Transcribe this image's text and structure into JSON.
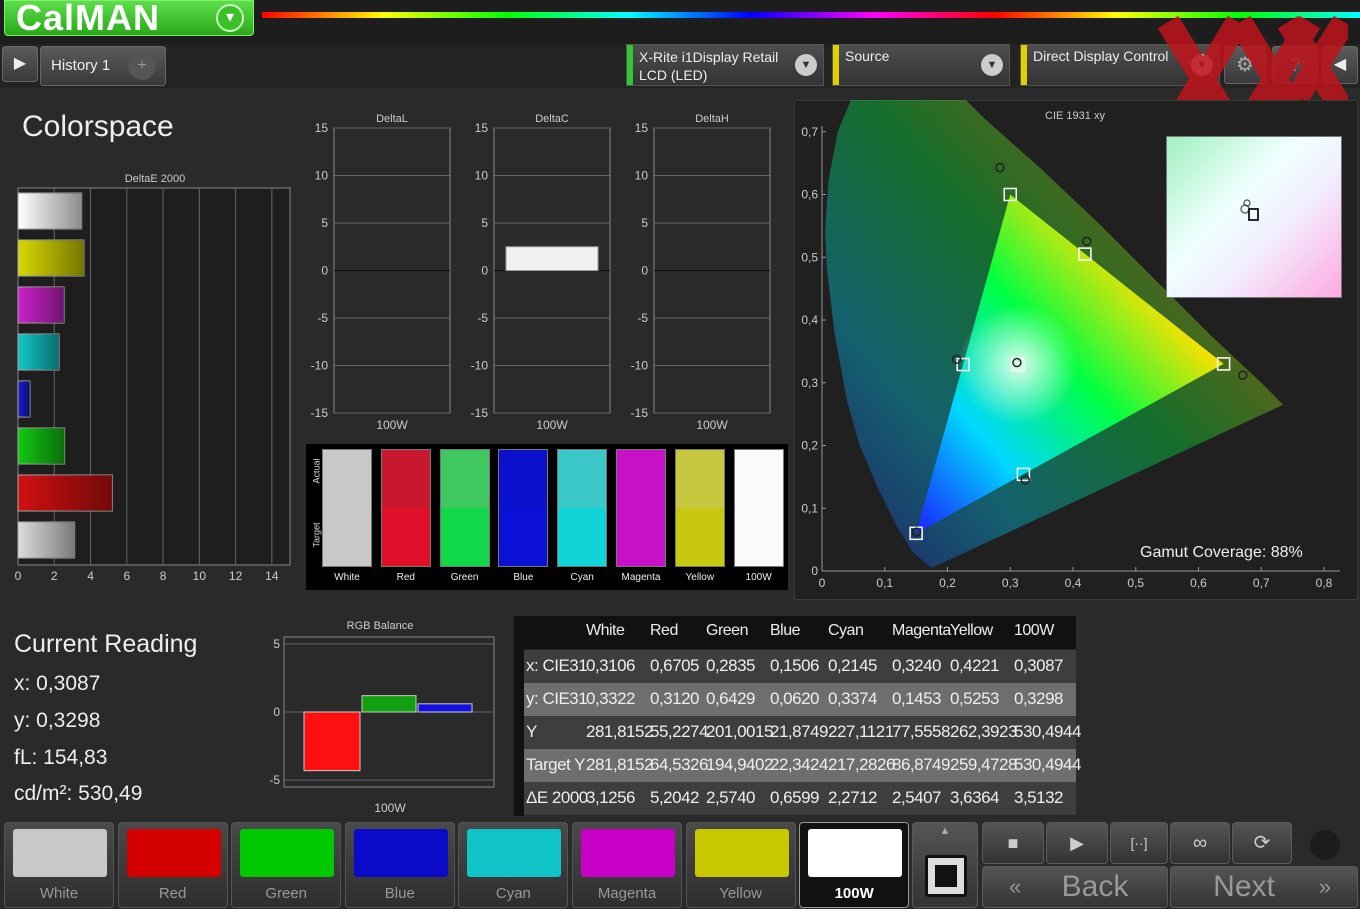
{
  "app": {
    "title": "CalMAN"
  },
  "tabs": {
    "history": "History 1"
  },
  "devices": {
    "meter": "X-Rite i1Display Retail LCD (LED)",
    "source": "Source",
    "display": "Direct Display Control"
  },
  "colorspace": {
    "title": "Colorspace"
  },
  "deltae_chart": {
    "title": "DeltaE 2000",
    "ticks": [
      "0",
      "2",
      "4",
      "6",
      "8",
      "10",
      "12",
      "14"
    ],
    "bars": [
      {
        "value": 3.5126,
        "color": "#ffffff"
      },
      {
        "value": 3.6364,
        "color": "#d8d800"
      },
      {
        "value": 2.5407,
        "color": "#cc22cc"
      },
      {
        "value": 2.2712,
        "color": "#12c8c8"
      },
      {
        "value": 0.6599,
        "color": "#1a1acc"
      },
      {
        "value": 2.574,
        "color": "#12c812"
      },
      {
        "value": 5.2042,
        "color": "#d01010"
      },
      {
        "value": 3.1256,
        "color": "#dddddd"
      }
    ]
  },
  "delta_charts": [
    {
      "title": "DeltaL",
      "label": "100W"
    },
    {
      "title": "DeltaC",
      "label": "100W"
    },
    {
      "title": "DeltaH",
      "label": "100W"
    }
  ],
  "delta_ticks": [
    "15",
    "10",
    "5",
    "0",
    "-5",
    "-10",
    "-15"
  ],
  "swatch_panel": {
    "actual_label": "Actual",
    "target_label": "Target",
    "items": [
      {
        "name": "White",
        "actual": "#c8c8c8",
        "target": "#c8c8c8"
      },
      {
        "name": "Red",
        "actual": "#c81830",
        "target": "#e0102a"
      },
      {
        "name": "Green",
        "actual": "#40c860",
        "target": "#10d84a"
      },
      {
        "name": "Blue",
        "actual": "#0a10cc",
        "target": "#0a10d4"
      },
      {
        "name": "Cyan",
        "actual": "#3ac8c8",
        "target": "#10d4d8"
      },
      {
        "name": "Magenta",
        "actual": "#c810c8",
        "target": "#c810c8"
      },
      {
        "name": "Yellow",
        "actual": "#c8c840",
        "target": "#c8c810"
      },
      {
        "name": "100W",
        "actual": "#fafafa",
        "target": "#fafafa"
      }
    ]
  },
  "cie": {
    "title": "CIE 1931 xy",
    "gamut_label": "Gamut Coverage:",
    "gamut_value": "88%",
    "x_ticks": [
      "0",
      "0,1",
      "0,2",
      "0,3",
      "0,4",
      "0,5",
      "0,6",
      "0,7",
      "0,8"
    ],
    "y_ticks": [
      "0",
      "0,1",
      "0,2",
      "0,3",
      "0,4",
      "0,5",
      "0,6",
      "0,7",
      "0,8"
    ]
  },
  "chart_data": {
    "type": "scatter",
    "title": "CIE 1931 xy",
    "xlim": [
      0,
      0.8
    ],
    "ylim": [
      0,
      0.8
    ],
    "targets": [
      {
        "name": "Red",
        "x": 0.64,
        "y": 0.33
      },
      {
        "name": "Green",
        "x": 0.3,
        "y": 0.6
      },
      {
        "name": "Blue",
        "x": 0.15,
        "y": 0.06
      },
      {
        "name": "Cyan",
        "x": 0.225,
        "y": 0.329
      },
      {
        "name": "Magenta",
        "x": 0.321,
        "y": 0.154
      },
      {
        "name": "Yellow",
        "x": 0.419,
        "y": 0.505
      },
      {
        "name": "White",
        "x": 0.3127,
        "y": 0.329
      }
    ],
    "measured": [
      {
        "name": "Red",
        "x": 0.6705,
        "y": 0.312
      },
      {
        "name": "Green",
        "x": 0.2835,
        "y": 0.6429
      },
      {
        "name": "Blue",
        "x": 0.1506,
        "y": 0.062
      },
      {
        "name": "Cyan",
        "x": 0.2145,
        "y": 0.3374
      },
      {
        "name": "Magenta",
        "x": 0.324,
        "y": 0.1453
      },
      {
        "name": "Yellow",
        "x": 0.4221,
        "y": 0.5253
      },
      {
        "name": "White",
        "x": 0.3106,
        "y": 0.3322
      }
    ]
  },
  "current_reading": {
    "title": "Current Reading",
    "x": "x: 0,3087",
    "y": "y: 0,3298",
    "fl": "fL: 154,83",
    "cdm2": "cd/m²: 530,49"
  },
  "rgb_balance": {
    "title": "RGB Balance",
    "label": "100W",
    "ticks": [
      "5",
      "0",
      "-5"
    ],
    "values": {
      "r": -4.3,
      "g": 1.2,
      "b": 0.6
    }
  },
  "table": {
    "headers": [
      "",
      "White",
      "Red",
      "Green",
      "Blue",
      "Cyan",
      "Magenta",
      "Yellow",
      "100W"
    ],
    "rows": [
      {
        "label": "x: CIE31",
        "values": [
          "0,3106",
          "0,6705",
          "0,2835",
          "0,1506",
          "0,2145",
          "0,3240",
          "0,4221",
          "0,3087"
        ]
      },
      {
        "label": "y: CIE31",
        "values": [
          "0,3322",
          "0,3120",
          "0,6429",
          "0,0620",
          "0,3374",
          "0,1453",
          "0,5253",
          "0,3298"
        ]
      },
      {
        "label": "Y",
        "values": [
          "281,8152",
          "55,2274",
          "201,0015",
          "21,8749",
          "227,1121",
          "77,5558",
          "262,3923",
          "530,4944"
        ]
      },
      {
        "label": "Target Y",
        "values": [
          "281,8152",
          "64,5326",
          "194,9402",
          "22,3424",
          "217,2826",
          "86,8749",
          "259,4728",
          "530,4944"
        ]
      },
      {
        "label": "ΔE 2000",
        "values": [
          "3,1256",
          "5,2042",
          "2,5740",
          "0,6599",
          "2,2712",
          "2,5407",
          "3,6364",
          "3,5132"
        ]
      }
    ]
  },
  "palette": [
    {
      "name": "White",
      "color": "#c8c8c8"
    },
    {
      "name": "Red",
      "color": "#d40000"
    },
    {
      "name": "Green",
      "color": "#00c800"
    },
    {
      "name": "Blue",
      "color": "#0a0ac8"
    },
    {
      "name": "Cyan",
      "color": "#10c4c8"
    },
    {
      "name": "Magenta",
      "color": "#c800c8"
    },
    {
      "name": "Yellow",
      "color": "#c8c800"
    },
    {
      "name": "100W",
      "color": "#ffffff"
    }
  ],
  "nav": {
    "back": "Back",
    "next": "Next"
  }
}
